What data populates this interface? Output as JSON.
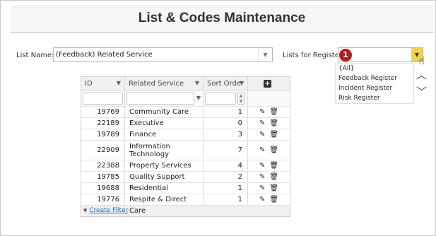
{
  "page": {
    "title": "List & Codes Maintenance"
  },
  "list_name": {
    "label": "List Name:",
    "value": "(Feedback) Related Service"
  },
  "lists_for_register": {
    "label": "Lists for Register:",
    "badge": "1",
    "options": [
      "{All}",
      "Feedback Register",
      "Incident Register",
      "Risk Register"
    ]
  },
  "grid": {
    "columns": [
      "ID",
      "Related Service",
      "Sort Order"
    ],
    "rows": [
      {
        "id": "19769",
        "service": "Community Care",
        "sort": "1"
      },
      {
        "id": "22189",
        "service": "Executive",
        "sort": "0"
      },
      {
        "id": "19789",
        "service": "Finance",
        "sort": "3"
      },
      {
        "id": "22909",
        "service": "Information Technology",
        "sort": "7"
      },
      {
        "id": "22388",
        "service": "Property Services",
        "sort": "4"
      },
      {
        "id": "19785",
        "service": "Quality Support",
        "sort": "2"
      },
      {
        "id": "19688",
        "service": "Residential",
        "sort": "1"
      },
      {
        "id": "19776",
        "service": "Respite & Direct Care",
        "sort": "1"
      }
    ],
    "footer_link": "Create Filter"
  },
  "icons": {
    "filter": "funnel-icon",
    "add": "plus-icon",
    "edit": "pencil-icon",
    "delete": "trash-icon",
    "cursor": "hand-cursor-icon"
  },
  "colors": {
    "badge": "#b41d1d",
    "dropdown_active": "#f5d44a",
    "link": "#2a6ab6"
  }
}
